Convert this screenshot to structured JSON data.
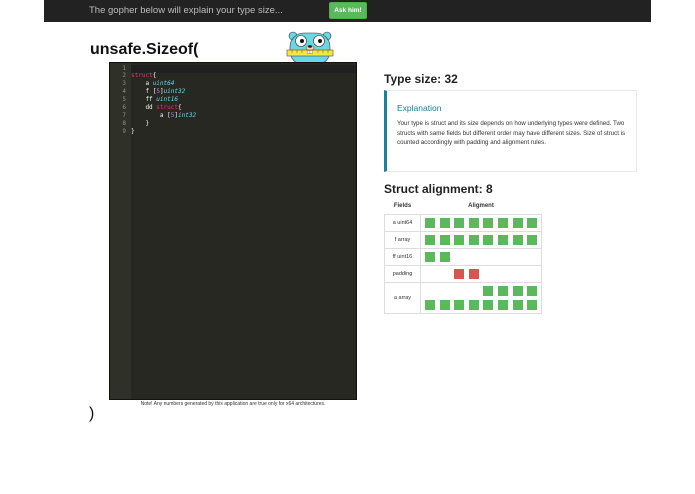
{
  "header": {
    "tagline": "The gopher below will explain your type size...",
    "ask_button": "Ask him!"
  },
  "title": "unsafe.Sizeof(",
  "closing_paren": ")",
  "editor": {
    "line_numbers": [
      "1",
      "2",
      "3",
      "4",
      "5",
      "6",
      "7",
      "8",
      "9"
    ],
    "lines": [
      [],
      [
        {
          "t": "struct",
          "c": "kw"
        },
        {
          "t": "{",
          "c": "fd"
        }
      ],
      [
        {
          "t": "    a ",
          "c": "fd"
        },
        {
          "t": "uint64",
          "c": "ty"
        }
      ],
      [
        {
          "t": "    f ",
          "c": "fd"
        },
        {
          "t": "[",
          "c": "fd"
        },
        {
          "t": "5",
          "c": "num"
        },
        {
          "t": "]",
          "c": "fd"
        },
        {
          "t": "uint32",
          "c": "ty"
        }
      ],
      [
        {
          "t": "    ff ",
          "c": "fd"
        },
        {
          "t": "uint16",
          "c": "ty"
        }
      ],
      [
        {
          "t": "    dd ",
          "c": "fd"
        },
        {
          "t": "struct",
          "c": "kw"
        },
        {
          "t": "{",
          "c": "fd"
        }
      ],
      [
        {
          "t": "        a ",
          "c": "fd"
        },
        {
          "t": "[",
          "c": "fd"
        },
        {
          "t": "5",
          "c": "num"
        },
        {
          "t": "]",
          "c": "fd"
        },
        {
          "t": "int32",
          "c": "ty"
        }
      ],
      [
        {
          "t": "    }",
          "c": "fd"
        }
      ],
      [
        {
          "t": "}",
          "c": "fd"
        }
      ]
    ]
  },
  "note": "Note! Any numbers generated by this application are true only for x64 architectures.",
  "type_size": "Type size: 32",
  "explanation": {
    "title": "Explanation",
    "body": "Your type is struct and its size depends on how underlying types were defined. Two structs with same fields but different order may have different sizes. Size of struct is counted accordingly with padding and alignment rules."
  },
  "struct_alignment": "Struct alignment: 8",
  "table": {
    "headers": [
      "Fields",
      "Aligment"
    ],
    "rows": [
      {
        "field": "a uint64",
        "rows": [
          [
            1,
            1,
            1,
            1,
            1,
            1,
            1,
            1
          ]
        ]
      },
      {
        "field": "f array",
        "rows": [
          [
            1,
            1,
            1,
            1,
            1,
            1,
            1,
            1
          ]
        ]
      },
      {
        "field": "ff uint16",
        "rows": [
          [
            1,
            1,
            0,
            0,
            0,
            0,
            0,
            0
          ]
        ]
      },
      {
        "field": "padding",
        "rows": [
          [
            0,
            0,
            2,
            2,
            0,
            0,
            0,
            0
          ]
        ]
      },
      {
        "field": "a array",
        "rows": [
          [
            0,
            0,
            0,
            0,
            1,
            1,
            1,
            1
          ],
          [
            1,
            1,
            1,
            1,
            1,
            1,
            1,
            1
          ]
        ]
      }
    ]
  },
  "colors": {
    "accent": "#1b809e",
    "button": "#5cb85c",
    "block_used": "#5cb85c",
    "block_padding": "#d9534f",
    "editor_bg": "#272822"
  },
  "icons": [
    "gopher-mascot-icon"
  ]
}
